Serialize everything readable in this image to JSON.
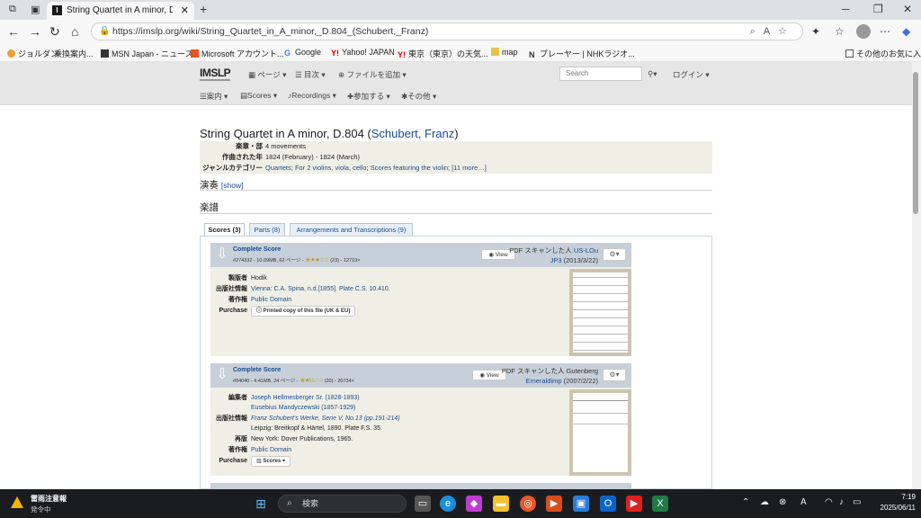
{
  "browser": {
    "tab_title": "String Quartet in A minor, D.804 (",
    "tab_favicon": "I",
    "url": "https://imslp.org/wiki/String_Quartet_in_A_minor,_D.804_(Schubert,_Franz)",
    "bookmarks": [
      "ジョルダン",
      "乗換案内...",
      "MSN Japan - ニュース...",
      "Microsoft アカウント...",
      "Google",
      "Yahoo! JAPAN",
      "東京（東京）の天気...",
      "map",
      "プレーヤー | NHKラジオ..."
    ],
    "other_favorites": "その他のお気に入り"
  },
  "site": {
    "logo": "IMSLP",
    "menu_top": [
      "ページ",
      "目次",
      "ファイルを追加"
    ],
    "search_placeholder": "Search",
    "login": "ログイン",
    "menu_bottom": [
      "案内",
      "Scores",
      "Recordings",
      "参加する",
      "その他"
    ]
  },
  "page": {
    "title": "String Quartet in A minor, D.804 (",
    "title_link": "Schubert, Franz",
    "title_close": ")",
    "info": [
      {
        "key": "楽章・部",
        "value": "4 movements"
      },
      {
        "key": "作曲された年",
        "value": "1824 (February) - 1824 (March)"
      },
      {
        "key": "ジャンルカテゴリー",
        "links": [
          "Quartets",
          "For 2 violins, viola, cello",
          "Scores featuring the violin"
        ],
        "more": "[11 more…]"
      }
    ],
    "performances_heading": "演奏",
    "show_link": "[show]",
    "scores_heading": "楽譜",
    "tabs": [
      "Scores (3)",
      "Parts (8)",
      "Arrangements and Transcriptions (9)"
    ]
  },
  "files": [
    {
      "title": "Complete Score",
      "meta": "#274332 - 10.09MB, 62 ページ - ",
      "rating": "(23) - 12719×",
      "stars": 3,
      "view": "View",
      "pdf_line1": "PDF スキャンした人",
      "uploader1": "US-LOu",
      "pdf_line2": "JP3",
      "date": "(2013/3/22)",
      "rows": [
        {
          "key": "製版者",
          "value": "Hodik"
        },
        {
          "key": "出版社情報",
          "value": "Vienna: C.A. Spina, n.d.[1855]. Plate C.S. 10.410."
        },
        {
          "key": "著作権",
          "value": "Public Domain"
        },
        {
          "key": "Purchase",
          "button": "Printed copy of this file (UK & EU)"
        }
      ]
    },
    {
      "title": "Complete Score",
      "meta": "#04040 - 4.41MB, 24 ページ - ",
      "rating": "(20) - 20734×",
      "stars": 2.5,
      "view": "View",
      "pdf_line1": "PDF スキャンした人 Gutenberg",
      "uploader1": "",
      "pdf_line2": "Emeraldimp",
      "date": "(2007/2/22)",
      "rows": [
        {
          "key": "編集者",
          "value": "Joseph Hellmesberger Sr. (1828-1893)"
        },
        {
          "key": "",
          "value": "Eusebius Mandyczewski (1857-1929)"
        },
        {
          "key": "出版社情報",
          "value": "Franz Schubert's Werke, Serie V, No.13 (pp.191-214)"
        },
        {
          "key": "",
          "value": "Leipzig: Breitkopf & Härtel, 1890. Plate F.S. 35."
        },
        {
          "key": "再版",
          "value": "New York: Dover Publications, 1965."
        },
        {
          "key": "著作権",
          "value": "Public Domain"
        },
        {
          "key": "Purchase",
          "button": "Scores"
        }
      ]
    }
  ],
  "taskbar": {
    "weather_title": "雷雨注意報",
    "weather_sub": "発令中",
    "search_placeholder": "検索",
    "time": "7:19",
    "date": "2025/06/11"
  }
}
